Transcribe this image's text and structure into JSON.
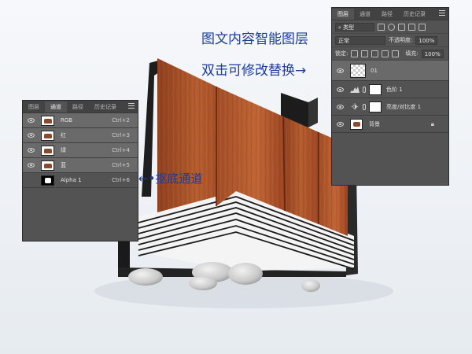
{
  "annotations": {
    "smart_layer_line1": "图文内容智能图层",
    "smart_layer_line2": "双击可修改替换→",
    "channel_note": "抠底通道"
  },
  "channels_panel": {
    "tabs": [
      {
        "label": "图层",
        "active": false
      },
      {
        "label": "通道",
        "active": true
      },
      {
        "label": "路径",
        "active": false
      },
      {
        "label": "历史记录",
        "active": false
      }
    ],
    "rows": [
      {
        "name": "RGB",
        "shortcut": "Ctrl+2",
        "visible": true,
        "thumb": "chair"
      },
      {
        "name": "红",
        "shortcut": "Ctrl+3",
        "visible": true,
        "thumb": "chair"
      },
      {
        "name": "绿",
        "shortcut": "Ctrl+4",
        "visible": true,
        "thumb": "chair"
      },
      {
        "name": "蓝",
        "shortcut": "Ctrl+5",
        "visible": true,
        "thumb": "chair"
      },
      {
        "name": "Alpha 1",
        "shortcut": "Ctrl+6",
        "visible": false,
        "thumb": "alpha"
      }
    ]
  },
  "layers_panel": {
    "tabs": [
      {
        "label": "图层",
        "active": true
      },
      {
        "label": "通道",
        "active": false
      },
      {
        "label": "路径",
        "active": false
      },
      {
        "label": "历史记录",
        "active": false
      }
    ],
    "filter_label": "类型",
    "blend_mode": "正常",
    "opacity_label": "不透明度:",
    "opacity_value": "100%",
    "lock_label": "锁定:",
    "fill_label": "填充:",
    "fill_value": "100%",
    "layers": [
      {
        "name": "01",
        "type": "smart",
        "selected": true
      },
      {
        "name": "色阶 1",
        "type": "levels",
        "selected": false
      },
      {
        "name": "亮度/对比度 1",
        "type": "brightness",
        "selected": false
      },
      {
        "name": "背景",
        "type": "background",
        "selected": false,
        "locked": true
      }
    ]
  },
  "colors": {
    "panel_bg": "#535353",
    "annotation": "#1b3b9d",
    "wood": "#a8512a"
  }
}
